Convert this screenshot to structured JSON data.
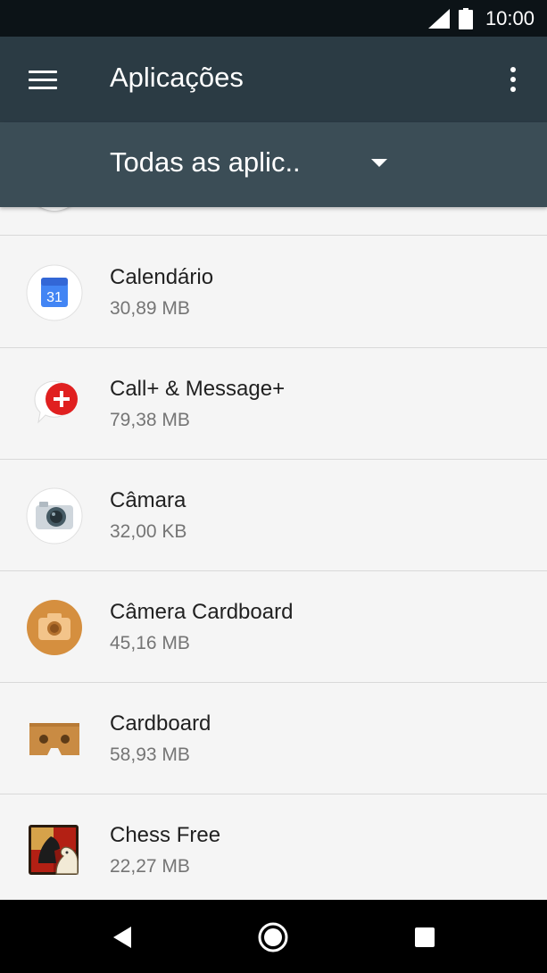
{
  "status_bar": {
    "time": "10:00",
    "icons": [
      "signal-icon",
      "battery-icon"
    ]
  },
  "toolbar": {
    "title": "Aplicações",
    "icons": [
      "menu-icon",
      "overflow-menu-icon"
    ]
  },
  "filter": {
    "selected": "Todas as aplic..",
    "icon": "dropdown-caret-icon"
  },
  "apps": [
    {
      "name": "Calendário",
      "size": "30,89 MB",
      "icon": "calendar-icon"
    },
    {
      "name": "Call+ & Message+",
      "size": "79,38 MB",
      "icon": "call-message-icon"
    },
    {
      "name": "Câmara",
      "size": "32,00 KB",
      "icon": "camera-icon"
    },
    {
      "name": "Câmera Cardboard",
      "size": "45,16 MB",
      "icon": "cardboard-camera-icon"
    },
    {
      "name": "Cardboard",
      "size": "58,93 MB",
      "icon": "cardboard-icon"
    },
    {
      "name": "Chess Free",
      "size": "22,27 MB",
      "icon": "chess-icon"
    }
  ],
  "nav_bar": {
    "icons": [
      "back-icon",
      "home-icon",
      "recents-icon"
    ]
  },
  "colors": {
    "status_bar": "#0c1317",
    "toolbar": "#2b3b44",
    "filter_bar": "#3b4d56",
    "list_background": "#f5f5f5",
    "nav_bar": "#000000"
  }
}
